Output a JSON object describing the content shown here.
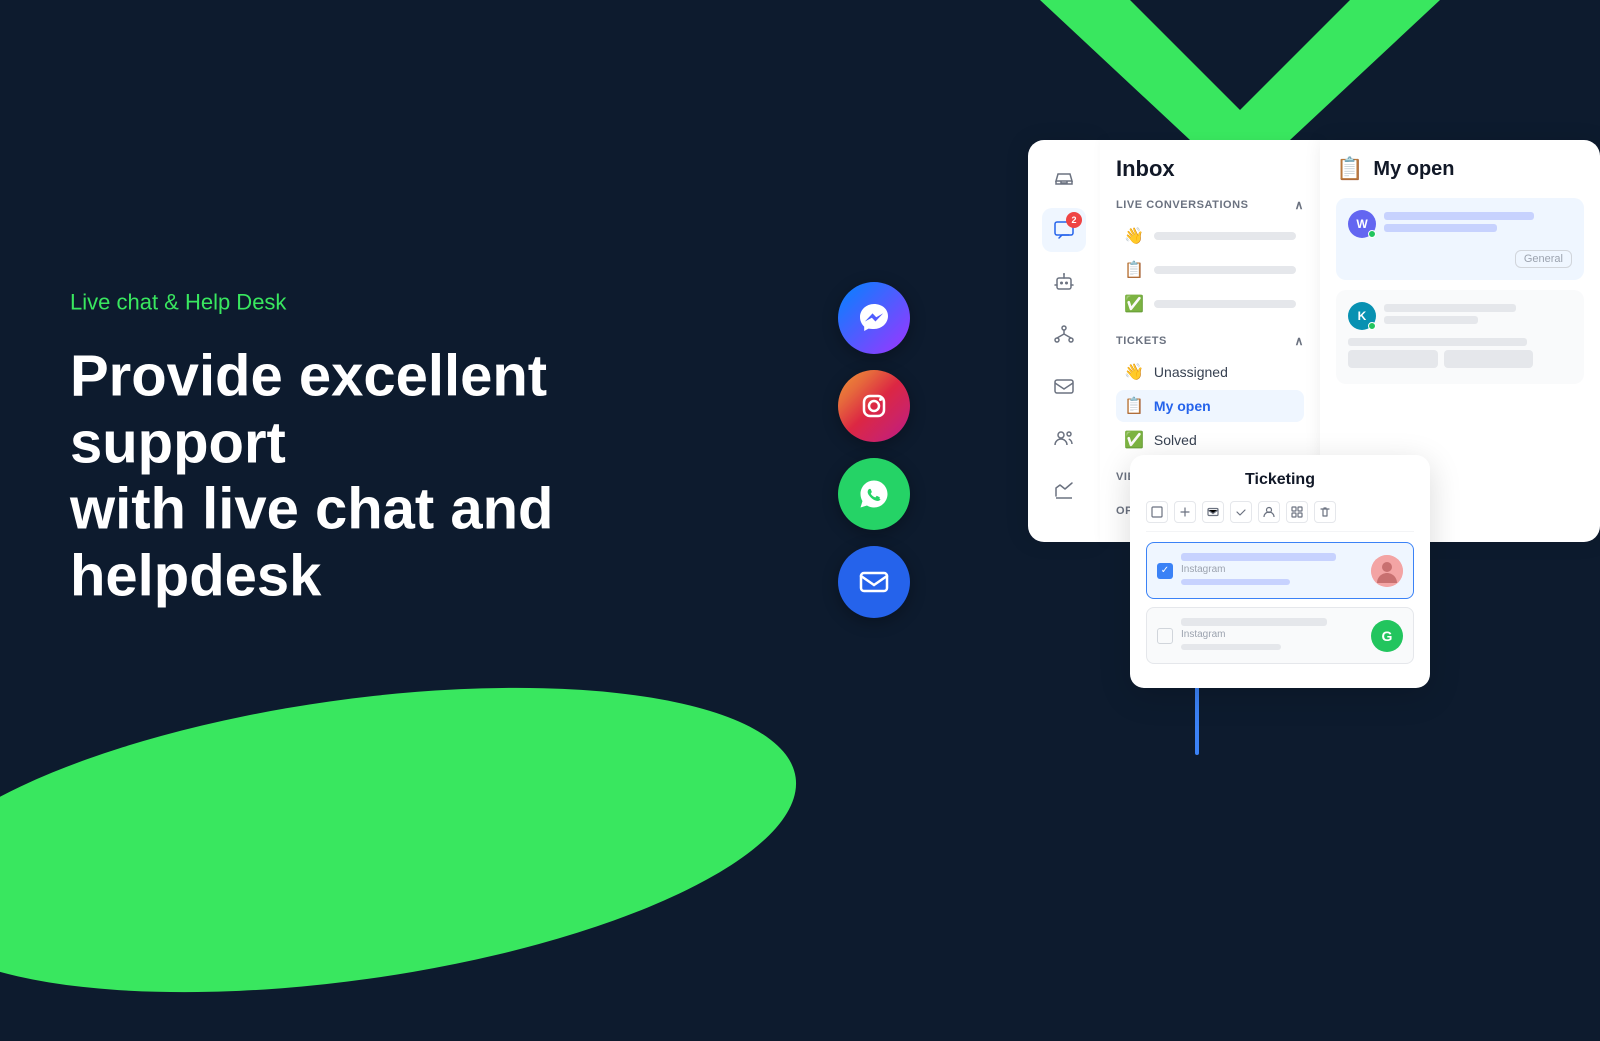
{
  "background": {
    "color": "#0d1b2e"
  },
  "tagline": "Live chat & Help Desk",
  "headline_line1": "Provide excellent support",
  "headline_line2": "with live chat and helpdesk",
  "social_icons": [
    {
      "name": "messenger",
      "emoji": "💬",
      "class": "social-messenger"
    },
    {
      "name": "instagram",
      "emoji": "📷",
      "class": "social-instagram"
    },
    {
      "name": "whatsapp",
      "emoji": "💬",
      "class": "social-whatsapp"
    },
    {
      "name": "email",
      "emoji": "✉",
      "class": "social-email"
    }
  ],
  "sidebar": {
    "icons": [
      {
        "name": "inbox",
        "emoji": "📥",
        "active": false
      },
      {
        "name": "messages",
        "emoji": "💬",
        "active": true,
        "badge": "2"
      },
      {
        "name": "bot",
        "emoji": "🤖",
        "active": false
      },
      {
        "name": "org",
        "emoji": "🏢",
        "active": false
      },
      {
        "name": "email2",
        "emoji": "✉",
        "active": false
      },
      {
        "name": "team",
        "emoji": "👥",
        "active": false
      },
      {
        "name": "chart",
        "emoji": "📊",
        "active": false
      }
    ]
  },
  "inbox_panel": {
    "title": "Inbox",
    "sections": [
      {
        "name": "LIVE CONVERSATIONS",
        "expanded": true,
        "items": [
          {
            "icon": "👋",
            "label": null,
            "active": false
          },
          {
            "icon": "📋",
            "label": null,
            "active": false
          },
          {
            "icon": "✅",
            "label": null,
            "active": false
          }
        ]
      },
      {
        "name": "TICKETS",
        "expanded": true,
        "items": [
          {
            "icon": "👋",
            "label": "Unassigned",
            "active": false
          },
          {
            "icon": "📋",
            "label": "My open",
            "active": true
          },
          {
            "icon": "✅",
            "label": "Solved",
            "active": false
          }
        ]
      },
      {
        "name": "VIEWS",
        "expanded": false
      },
      {
        "name": "OPERATORS",
        "expanded": false
      }
    ]
  },
  "myopen_panel": {
    "title": "My open",
    "icon": "📋",
    "conversations": [
      {
        "avatar_letter": "W",
        "avatar_class": "w-avatar",
        "online": true,
        "tag": "General"
      },
      {
        "avatar_letter": "K",
        "avatar_class": "k-avatar",
        "online": true,
        "tag": null
      }
    ]
  },
  "ticketing_panel": {
    "title": "Ticketing",
    "toolbar_buttons": [
      "□",
      "↔",
      "✉",
      "✓",
      "👤",
      "⊞",
      "🗑"
    ],
    "tickets": [
      {
        "selected": true,
        "source": "Instagram",
        "has_photo": true
      },
      {
        "selected": false,
        "source": "Instagram",
        "avatar_letter": "G",
        "avatar_class": "green"
      }
    ]
  }
}
